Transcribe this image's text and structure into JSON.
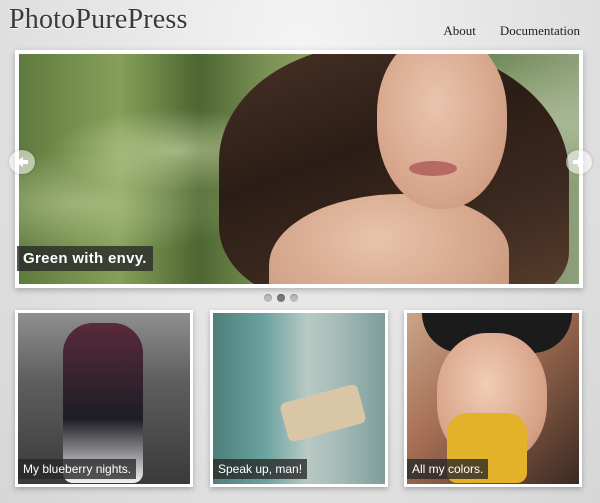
{
  "site": {
    "title": "PhotoPurePress"
  },
  "nav": {
    "items": [
      "About",
      "Documentation"
    ]
  },
  "slider": {
    "caption": "Green with envy.",
    "dots_total": 3,
    "active_dot": 1
  },
  "gallery": [
    {
      "caption": "My blueberry nights."
    },
    {
      "caption": "Speak up, man!"
    },
    {
      "caption": "All my colors."
    }
  ]
}
